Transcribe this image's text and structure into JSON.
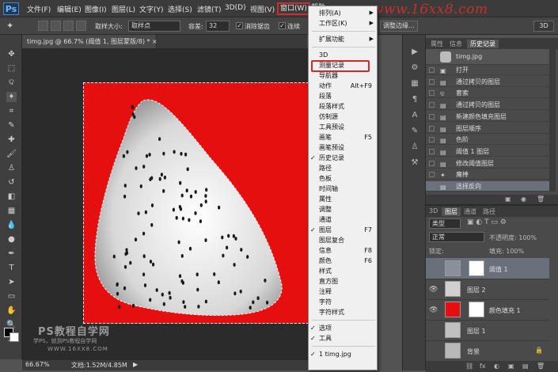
{
  "app": {
    "logo": "Ps"
  },
  "menubar": {
    "items": [
      "文件(F)",
      "编辑(E)",
      "图像(I)",
      "图层(L)",
      "文字(Y)",
      "选择(S)",
      "滤镜(T)",
      "3D(D)",
      "视图(V)",
      "窗口(W)",
      "帮助"
    ],
    "watermark": "www.16xx8.com"
  },
  "options": {
    "sample_size_label": "取样大小:",
    "sample_size_value": "取样点",
    "tolerance_label": "容差:",
    "tolerance_value": "32",
    "antialias_label": "消除锯齿",
    "contiguous_label": "连续",
    "refine_edge": "调整边缘...",
    "btn_3d": "3D"
  },
  "document": {
    "tab_title": "timg.jpg @ 66.7% (阈值 1, 图层蒙版/8) *",
    "tab_close": "×",
    "zoom": "66.67%",
    "doc_info": "文档:1.52M/4.85M",
    "status_arrow": "▶"
  },
  "canvas_watermark": {
    "line1": "PS教程自学网",
    "line2": "学PS，就到PS教程自学网",
    "line3": "WWW.16XX8.COM"
  },
  "window_menu": {
    "items": [
      {
        "label": "排列(A)",
        "arrow": "▶"
      },
      {
        "label": "工作区(K)",
        "arrow": "▶"
      },
      {
        "sep": true
      },
      {
        "label": "扩展功能",
        "arrow": "▶"
      },
      {
        "sep": true
      },
      {
        "label": "3D"
      },
      {
        "label": "测量记录"
      },
      {
        "label": "导航器"
      },
      {
        "label": "动作",
        "shortcut": "Alt+F9"
      },
      {
        "label": "段落"
      },
      {
        "label": "段落样式"
      },
      {
        "label": "仿制源"
      },
      {
        "label": "工具预设"
      },
      {
        "label": "画笔",
        "shortcut": "F5"
      },
      {
        "label": "画笔预设"
      },
      {
        "label": "历史记录",
        "checked": "✓"
      },
      {
        "label": "路径"
      },
      {
        "label": "色板"
      },
      {
        "label": "时间轴"
      },
      {
        "label": "属性"
      },
      {
        "label": "调整"
      },
      {
        "label": "通道"
      },
      {
        "label": "图层",
        "shortcut": "F7",
        "checked": "✓"
      },
      {
        "label": "图层复合"
      },
      {
        "label": "信息",
        "shortcut": "F8"
      },
      {
        "label": "颜色",
        "shortcut": "F6"
      },
      {
        "label": "样式"
      },
      {
        "label": "直方图"
      },
      {
        "label": "注释"
      },
      {
        "label": "字符"
      },
      {
        "label": "字符样式"
      },
      {
        "sep": true
      },
      {
        "label": "选项",
        "checked": "✓"
      },
      {
        "label": "工具",
        "checked": "✓"
      },
      {
        "sep": true
      },
      {
        "label": "1 timg.jpg",
        "checked": "✓"
      }
    ]
  },
  "history_panel": {
    "tabs": [
      "属性",
      "信息",
      "历史记录"
    ],
    "snapshot": "timg.jpg",
    "items": [
      "打开",
      "通过拷贝的图层",
      "套索",
      "通过拷贝的图层",
      "新建颜色填充图层",
      "图层顺序",
      "色阶",
      "阈值 1 图层",
      "修改阈值图层",
      "魔棒",
      "选择反向"
    ],
    "footer_icons": [
      "▣",
      "◉",
      "🗑"
    ]
  },
  "layers_panel": {
    "tabs": [
      "3D",
      "图层",
      "通道",
      "路径"
    ],
    "kind": "类型",
    "blend": "正常",
    "opacity": "不透明度: 100%",
    "lock": "锁定:",
    "fill": "填充: 100%",
    "layers": [
      {
        "name": "阈值 1",
        "selected": true,
        "eye": "",
        "thumb_color": "#8a8f9c"
      },
      {
        "name": "图层 2",
        "eye": "👁",
        "thumb_color": "#d0d0d0"
      },
      {
        "name": "颜色填充 1",
        "eye": "👁",
        "thumb_color": "#e60f0f"
      },
      {
        "name": "图层 1",
        "eye": "",
        "thumb_color": "#c0c0c0"
      },
      {
        "name": "背景",
        "eye": "",
        "thumb_color": "#b8b8b8"
      }
    ],
    "footer_icons": [
      "⛓",
      "fx",
      "◐",
      "▣",
      "▤",
      "🗑"
    ]
  },
  "colors": {
    "canvas_red": "#e60f0f",
    "highlight": "#d52a2a"
  }
}
